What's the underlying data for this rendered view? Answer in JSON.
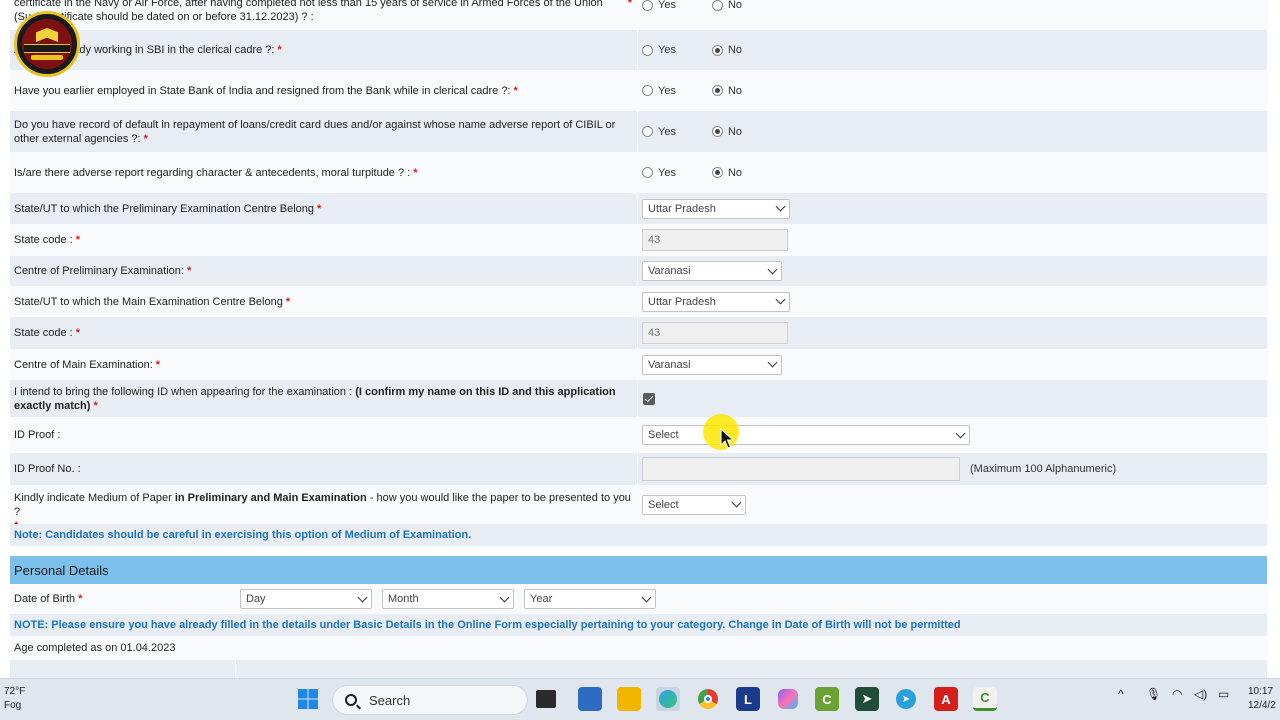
{
  "questions": {
    "q_armed_forces": {
      "label": "certificate in the Navy or Air Force, after having completed not less than 15 years of service in Armed Forces of the Union (Such certificate should be dated on or before 31.12.2023) ? :",
      "yes": "Yes",
      "no": "No"
    },
    "q_sbi_clerical": {
      "label": "Are you already working in SBI in the clerical cadre ?:",
      "yes": "Yes",
      "no": "No",
      "selected": "No"
    },
    "q_resigned": {
      "label": "Have you earlier employed in State Bank of India and resigned from the Bank while in clerical cadre ?:",
      "yes": "Yes",
      "no": "No",
      "selected": "No"
    },
    "q_default": {
      "label": "Do you have record of default in repayment of loans/credit card dues and/or against whose name adverse report of CIBIL or other external agencies ?:",
      "yes": "Yes",
      "no": "No",
      "selected": "No"
    },
    "q_adverse": {
      "label": "Is/are there adverse report regarding character & antecedents, moral turpitude ? :",
      "yes": "Yes",
      "no": "No",
      "selected": "No"
    }
  },
  "fields": {
    "prelim_state": {
      "label": "State/UT to which the Preliminary Examination Centre Belong",
      "value": "Uttar Pradesh"
    },
    "prelim_state_code": {
      "label": "State code :",
      "value": "43"
    },
    "prelim_centre": {
      "label": "Centre of Preliminary Examination:",
      "value": "Varanasi"
    },
    "main_state": {
      "label": "State/UT to which the Main Examination Centre Belong",
      "value": "Uttar Pradesh"
    },
    "main_state_code": {
      "label": "State code :",
      "value": "43"
    },
    "main_centre": {
      "label": "Centre of Main Examination:",
      "value": "Varanasi"
    },
    "id_intent": {
      "label_plain": "I intend to bring the following ID when appearing for the examination :",
      "label_bold": "(I confirm my name on this ID and this application exactly match)",
      "checked": true
    },
    "id_proof": {
      "label": "ID Proof :",
      "value": "Select"
    },
    "id_proof_no": {
      "label": "ID Proof No. :",
      "value": "",
      "hint": "(Maximum 100 Alphanumeric)"
    },
    "medium": {
      "label_plain": "Kindly indicate Medium of Paper",
      "label_bold": "in Preliminary and Main Examination",
      "label_tail": "- how you would like the paper to be presented to you ?",
      "value": "Select"
    }
  },
  "required_mark": "*",
  "note_medium": "Note: Candidates should be careful in exercising this option of Medium of Examination.",
  "personal": {
    "section_title": "Personal Details",
    "dob_label": "Date of Birth",
    "dob_day": "Day",
    "dob_month": "Month",
    "dob_year": "Year",
    "note_dob": "NOTE: Please ensure you have already filled in the details under Basic Details in the Online Form especially pertaining to your category. Change in Date of Birth will not be permitted",
    "age_label": "Age completed as on 01.04.2023"
  },
  "taskbar": {
    "weather_temp": "72°F",
    "weather_desc": "Fog",
    "search_placeholder": "Search",
    "clock_time": "10:17",
    "clock_date": "12/4/2"
  },
  "colors": {
    "row_shade": "#e7edf2",
    "section_header": "#7cc0eb",
    "note_text": "#1e73be",
    "required": "#d9191c"
  }
}
